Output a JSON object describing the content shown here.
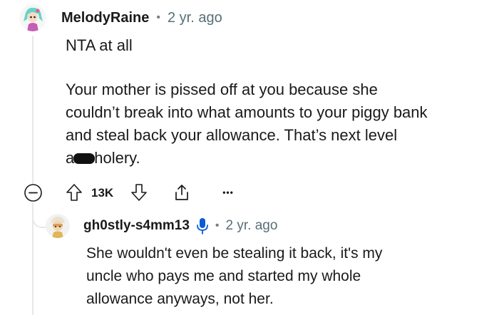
{
  "comment": {
    "username": "MelodyRaine",
    "separator": "•",
    "time": "2 yr. ago",
    "paragraph1": "NTA at all",
    "line1": "Your mother is pissed off at you because she",
    "line2": "couldn’t break into what amounts to your piggy bank",
    "line3": "and steal back your allowance. That’s next level",
    "line4_prefix": "a",
    "line4_suffix": "holery.",
    "vote_count": "13K",
    "more_label": "•••"
  },
  "reply": {
    "username": "gh0stly-s4mm13",
    "separator": "•",
    "time": "2 yr. ago",
    "line1": "She wouldn't even be stealing it back, it's my",
    "line2": "uncle who pays me and started my whole",
    "line3": "allowance anyways, not her."
  },
  "colors": {
    "text": "#1a1a1b",
    "meta": "#576f76",
    "thread": "#e6e8ea",
    "mic_icon": "#0b5bd6"
  },
  "icons": [
    "collapse-icon",
    "upvote-icon",
    "downvote-icon",
    "share-icon",
    "more-icon",
    "microphone-icon"
  ]
}
